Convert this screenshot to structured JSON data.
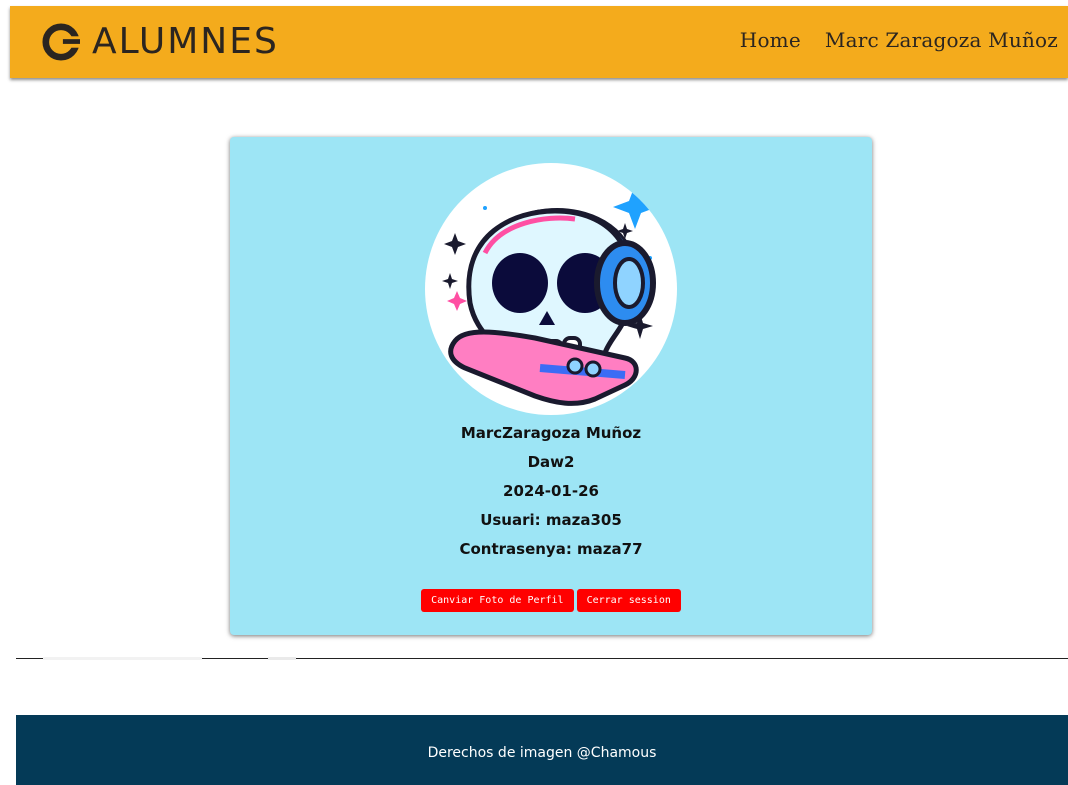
{
  "header": {
    "brand_text": "ALUMNES",
    "nav": {
      "home": "Home",
      "user": "Marc Zaragoza Muñoz"
    },
    "color": "#f4ab1c"
  },
  "profile": {
    "avatar_icon": "skull-headphones-avatar-icon",
    "name": "MarcZaragoza Muñoz",
    "group": "Daw2",
    "date": "2024-01-26",
    "user": "Usuari: maza305",
    "password": "Contrasenya: maza77",
    "buttons": {
      "change_photo": "Canviar Foto de Perfil",
      "logout": "Cerrar session"
    },
    "card_color": "#9de5f5",
    "button_color": "#ff0000"
  },
  "footer": {
    "text": "Derechos de imagen @Chamous",
    "color": "#043a57"
  }
}
